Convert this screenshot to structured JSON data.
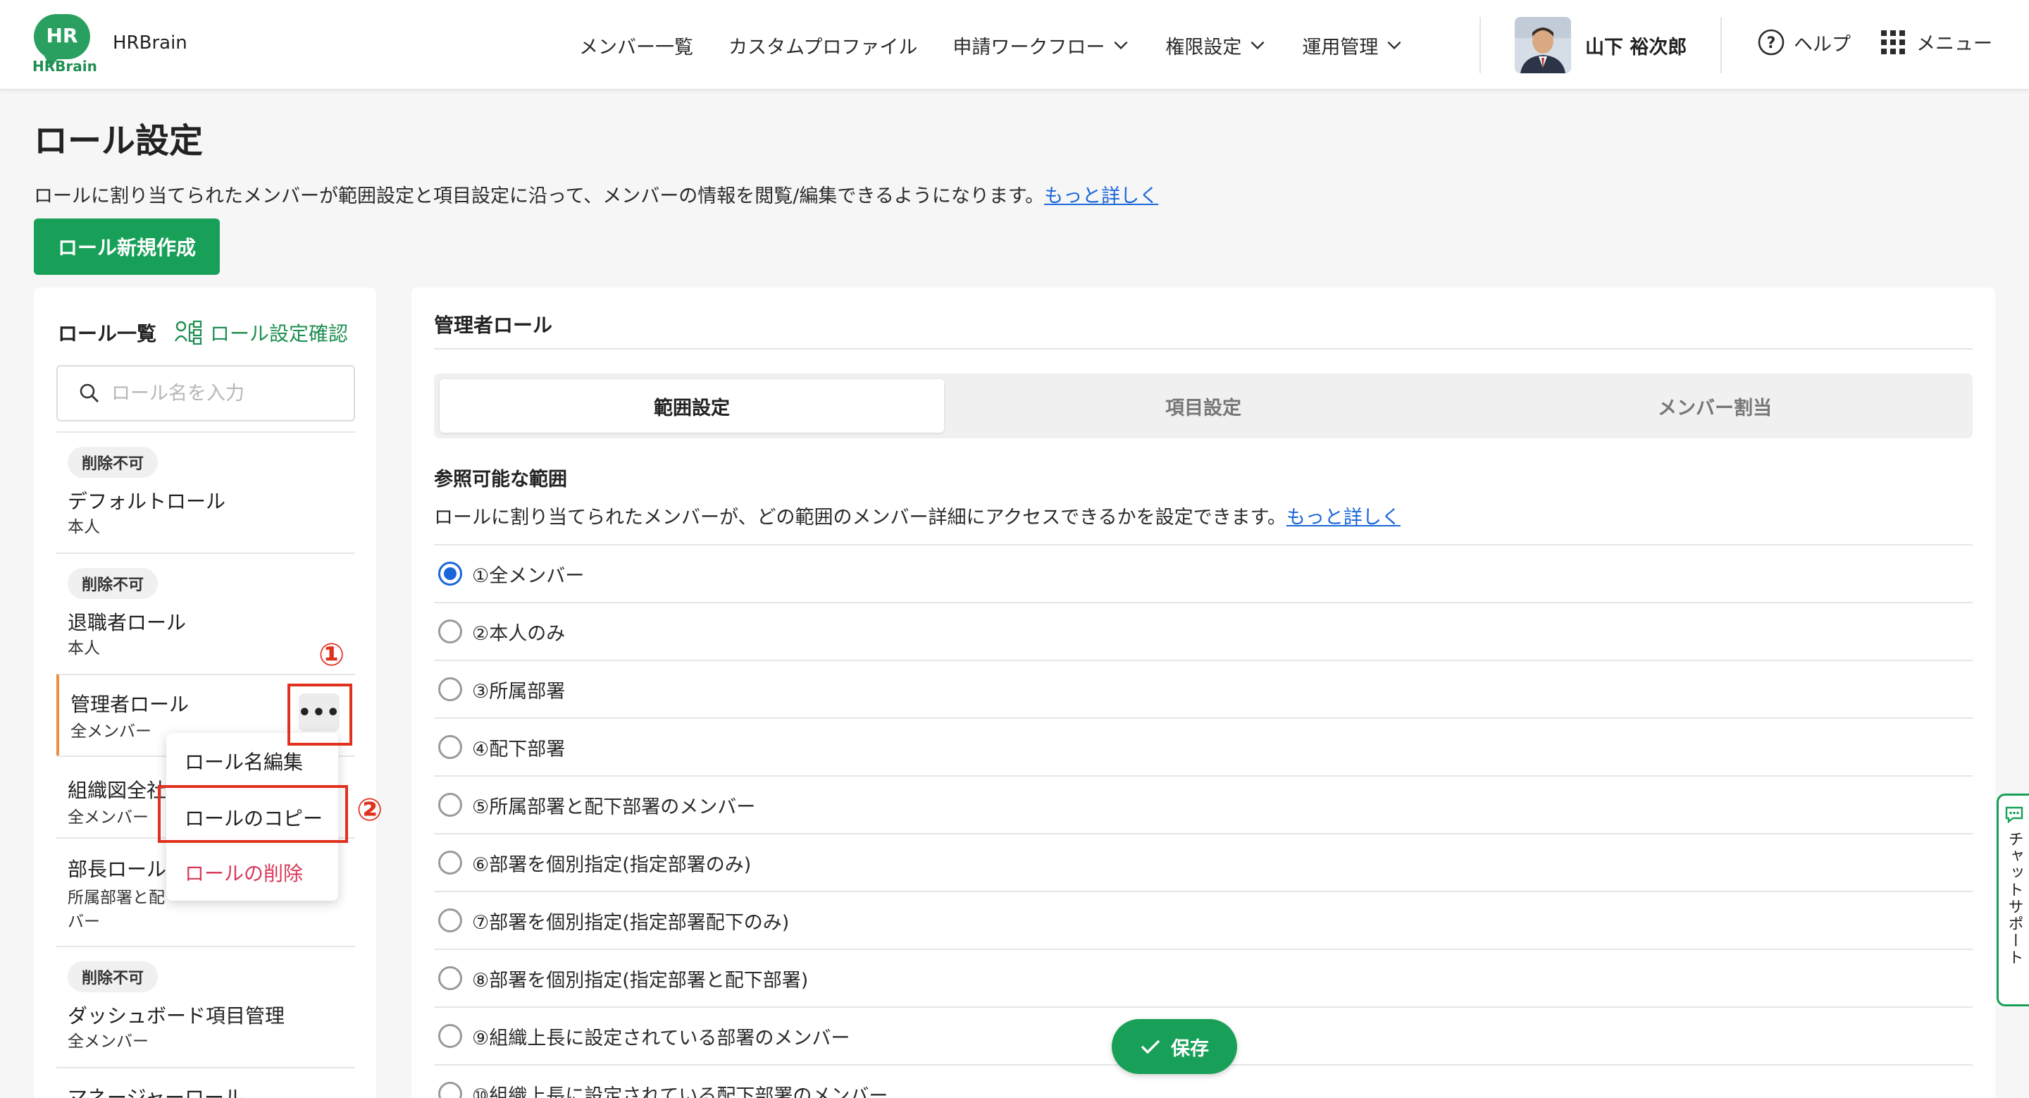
{
  "header": {
    "logo_text": "HR",
    "logo_sub": "HRBrain",
    "brand": "HRBrain",
    "nav": [
      {
        "label": "メンバー一覧",
        "dropdown": false
      },
      {
        "label": "カスタムプロファイル",
        "dropdown": false
      },
      {
        "label": "申請ワークフロー",
        "dropdown": true
      },
      {
        "label": "権限設定",
        "dropdown": true
      },
      {
        "label": "運用管理",
        "dropdown": true
      }
    ],
    "user_name": "山下 裕次郎",
    "help": "ヘルプ",
    "menu": "メニュー"
  },
  "page": {
    "title": "ロール設定",
    "description": "ロールに割り当てられたメンバーが範囲設定と項目設定に沿って、メンバーの情報を閲覧/編集できるようになります。",
    "description_link": "もっと詳しく",
    "new_button": "ロール新規作成"
  },
  "role_panel": {
    "title": "ロール一覧",
    "check_link": "ロール設定確認",
    "search_placeholder": "ロール名を入力",
    "roles": [
      {
        "badge": "削除不可",
        "name": "デフォルトロール",
        "scope": "本人"
      },
      {
        "badge": "削除不可",
        "name": "退職者ロール",
        "scope": "本人"
      },
      {
        "badge": "",
        "name": "管理者ロール",
        "scope": "全メンバー"
      },
      {
        "badge": "",
        "name": "組織図全社",
        "scope": "全メンバー"
      },
      {
        "badge": "",
        "name": "部長ロール",
        "scope": "所属部署と配",
        "scope2": "バー"
      },
      {
        "badge": "削除不可",
        "name": "ダッシュボード項目管理",
        "scope": "全メンバー"
      },
      {
        "badge": "",
        "name": "マネージャーロール",
        "scope": ""
      }
    ],
    "more_button": "•••"
  },
  "context_menu": {
    "items": [
      "ロール名編集",
      "ロールのコピー",
      "ロールの削除"
    ]
  },
  "annotations": {
    "step1": "①",
    "step2": "②"
  },
  "detail": {
    "title": "管理者ロール",
    "tabs": [
      "範囲設定",
      "項目設定",
      "メンバー割当"
    ],
    "active_tab": 0,
    "section_title": "参照可能な範囲",
    "section_desc": "ロールに割り当てられたメンバーが、どの範囲のメンバー詳細にアクセスできるかを設定できます。",
    "section_link": "もっと詳しく",
    "options": [
      "①全メンバー",
      "②本人のみ",
      "③所属部署",
      "④配下部署",
      "⑤所属部署と配下部署のメンバー",
      "⑥部署を個別指定(指定部署のみ)",
      "⑦部署を個別指定(指定部署配下のみ)",
      "⑧部署を個別指定(指定部署と配下部署)",
      "⑨組織上長に設定されている部署のメンバー",
      "⑩組織上長に設定されている配下部署のメンバー"
    ],
    "selected_option": 0,
    "save_button": "保存"
  },
  "chat_support": "チャットサポート",
  "colors": {
    "brand_green": "#18a058",
    "link_blue": "#1a66d9",
    "annotation_red": "#e0301e",
    "danger_pink": "#d9395a",
    "active_accent": "#f08c3c"
  },
  "icons": [
    "chevron-down-icon",
    "help-icon",
    "grid-menu-icon",
    "search-icon",
    "role-tree-icon",
    "check-icon",
    "chat-icon"
  ]
}
